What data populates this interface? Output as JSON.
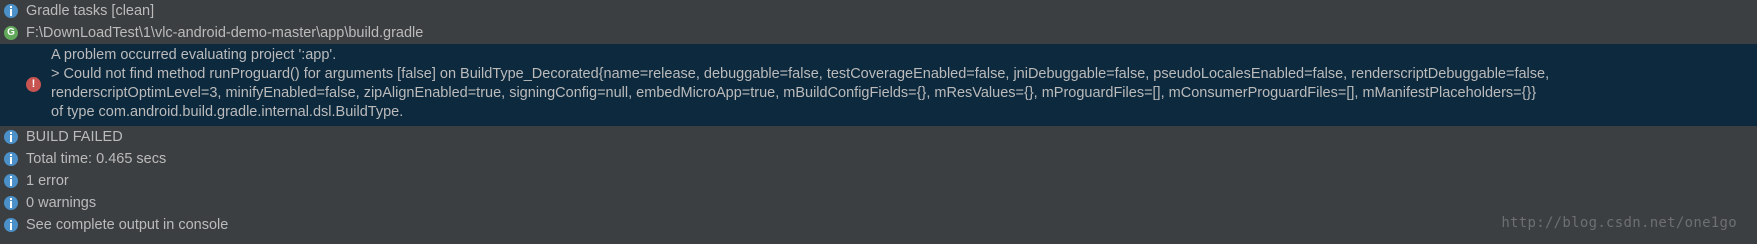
{
  "messages": {
    "gradle_tasks": "Gradle tasks [clean]",
    "build_file": "F:\\DownLoadTest\\1\\vlc-android-demo-master\\app\\build.gradle",
    "error": {
      "line1": "A problem occurred evaluating project ':app'.",
      "line2": "> Could not find method runProguard() for arguments [false] on BuildType_Decorated{name=release, debuggable=false, testCoverageEnabled=false, jniDebuggable=false, pseudoLocalesEnabled=false, renderscriptDebuggable=false,",
      "line3": "renderscriptOptimLevel=3, minifyEnabled=false, zipAlignEnabled=true, signingConfig=null, embedMicroApp=true, mBuildConfigFields={}, mResValues={}, mProguardFiles=[], mConsumerProguardFiles=[], mManifestPlaceholders={}}",
      "line4": "of type com.android.build.gradle.internal.dsl.BuildType."
    },
    "build_failed": "BUILD FAILED",
    "total_time": "Total time: 0.465 secs",
    "errors_count": "1 error",
    "warnings_count": "0 warnings",
    "see_output": "See complete output in console"
  },
  "icons": {
    "info": "info-icon",
    "gradle": "gradle-icon",
    "gradle_letter": "G",
    "error": "error-icon",
    "error_glyph": "!"
  },
  "watermark": "http://blog.csdn.net/one1go",
  "colors": {
    "background": "#3c3f41",
    "selected_row": "#0d293e",
    "text": "#bbbbbb",
    "info_icon": "#4b90c9",
    "gradle_icon": "#62a85b",
    "error_icon": "#c75450"
  }
}
